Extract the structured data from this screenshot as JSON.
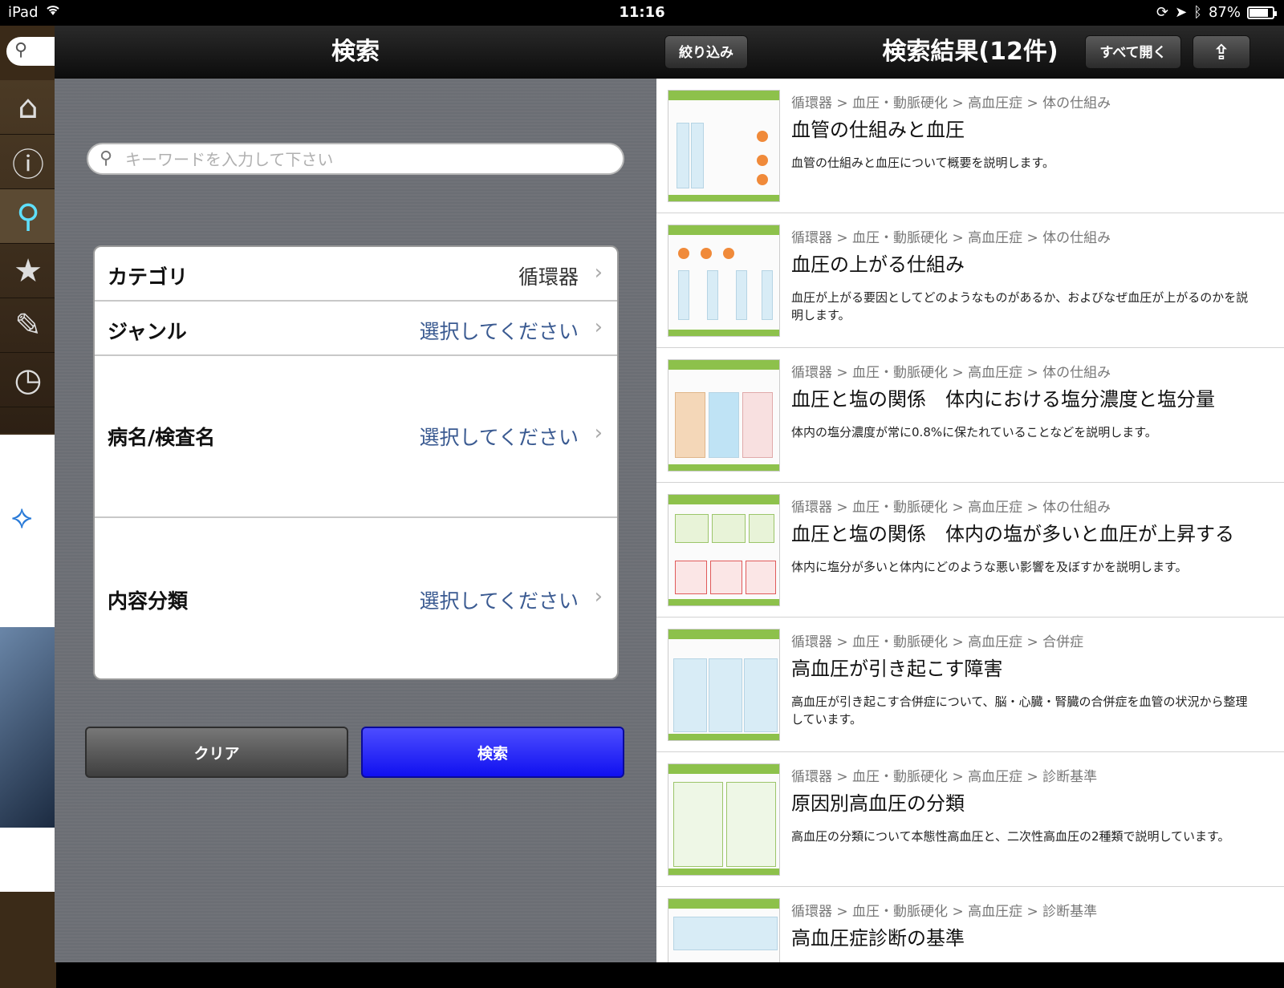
{
  "status": {
    "device": "iPad",
    "time": "11:16",
    "battery": "87%",
    "battery_level": 0.87
  },
  "popover": {
    "title": "検索",
    "search_placeholder": "キーワードを入力して下さい",
    "rows": [
      {
        "label": "カテゴリ",
        "value": "循環器"
      },
      {
        "label": "ジャンル",
        "value": "選択してください"
      },
      {
        "label": "病名/検査名",
        "value": "選択してください"
      },
      {
        "label": "内容分類",
        "value": "選択してください"
      }
    ],
    "clear_label": "クリア",
    "search_label": "検索"
  },
  "results": {
    "title": "検索結果(12件)",
    "filter_label": "絞り込み",
    "open_all_label": "すべて開く",
    "items": [
      {
        "path": "循環器 > 血圧・動脈硬化 > 高血圧症 > 体の仕組み",
        "title": "血管の仕組みと血圧",
        "desc": "血管の仕組みと血圧について概要を説明します。"
      },
      {
        "path": "循環器 > 血圧・動脈硬化 > 高血圧症 > 体の仕組み",
        "title": "血圧の上がる仕組み",
        "desc": "血圧が上がる要因としてどのようなものがあるか、およびなぜ血圧が上がるのかを説明します。"
      },
      {
        "path": "循環器 > 血圧・動脈硬化 > 高血圧症 > 体の仕組み",
        "title": "血圧と塩の関係　体内における塩分濃度と塩分量",
        "desc": "体内の塩分濃度が常に0.8%に保たれていることなどを説明します。"
      },
      {
        "path": "循環器 > 血圧・動脈硬化 > 高血圧症 > 体の仕組み",
        "title": "血圧と塩の関係　体内の塩が多いと血圧が上昇する",
        "desc": "体内に塩分が多いと体内にどのような悪い影響を及ぼすかを説明します。"
      },
      {
        "path": "循環器 > 血圧・動脈硬化 > 高血圧症 > 合併症",
        "title": "高血圧が引き起こす障害",
        "desc": "高血圧が引き起こす合併症について、脳・心臓・腎臓の合併症を血管の状況から整理しています。"
      },
      {
        "path": "循環器 > 血圧・動脈硬化 > 高血圧症 > 診断基準",
        "title": "原因別高血圧の分類",
        "desc": "高血圧の分類について本態性高血圧と、二次性高血圧の2種類で説明しています。"
      },
      {
        "path": "循環器 > 血圧・動脈硬化 > 高血圧症 > 診断基準",
        "title": "高血圧症診断の基準",
        "desc": ""
      }
    ]
  }
}
